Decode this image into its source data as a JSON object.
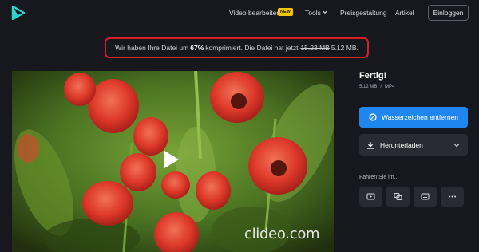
{
  "nav": {
    "video_edit": "Video bearbeiten",
    "new_badge": "NEW",
    "tools": "Tools",
    "pricing": "Preisgestaltung",
    "articles": "Artikel",
    "login": "Einloggen"
  },
  "notice": {
    "prefix": "Wir haben Ihre Datei um",
    "percent": "67%",
    "middle": "komprimiert. Die Datei hat jetzt",
    "old_size": "15.23 MB",
    "new_size": "5.12 MB."
  },
  "video": {
    "watermark": "clideo.com"
  },
  "sidebar": {
    "title": "Fertig!",
    "file_size": "5.12 MB",
    "separator": "/",
    "file_type": "MP4",
    "remove_watermark": "Wasserzeichen entfernen",
    "download": "Herunterladen",
    "continue_label": "Fahren Sie im..."
  },
  "icons": {
    "logo": "play-logo-icon",
    "tools_dropdown": "chevron-down-icon",
    "remove": "block-icon",
    "download": "download-icon",
    "download_options": "chevron-down-icon",
    "tool_1": "video-player-icon",
    "tool_2": "merge-icon",
    "tool_3": "subtitles-icon",
    "tool_4": "more-icon"
  },
  "colors": {
    "accent_blue": "#1f86f0",
    "highlight_border": "#d51f25",
    "badge_yellow": "#f5c400",
    "logo_teal": "#2fd2c9"
  }
}
